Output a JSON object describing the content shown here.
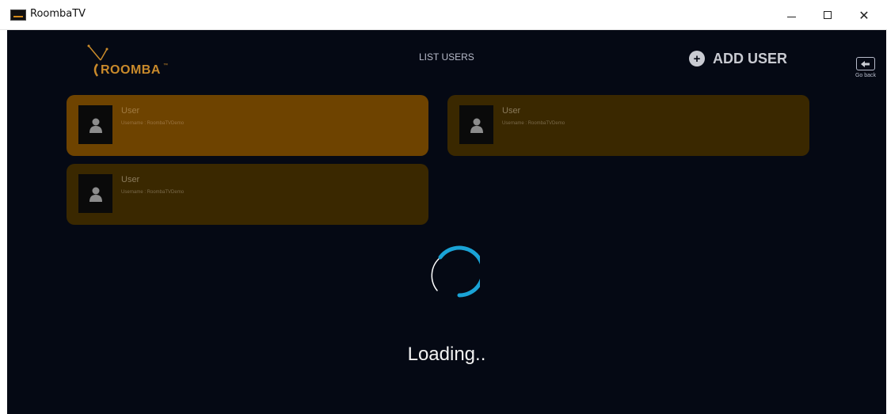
{
  "window": {
    "title": "RoombaTV",
    "minimize_glyph": "",
    "maximize_glyph": "",
    "close_glyph": "✕"
  },
  "header": {
    "logo_text": "ROOMBA",
    "logo_tm": "™",
    "title": "LIST USERS",
    "add_user_label": "ADD USER",
    "add_user_icon": "+",
    "go_back_label": "Go back"
  },
  "users": [
    {
      "name": "User",
      "username": "Username : RoombaTVDemo",
      "selected": true
    },
    {
      "name": "User",
      "username": "Username : RoombaTVDemo",
      "selected": false
    },
    {
      "name": "User",
      "username": "Username : RoombaTVDemo",
      "selected": false
    }
  ],
  "loading": {
    "text": "Loading.."
  },
  "colors": {
    "background": "#050914",
    "card_selected": "#6e4300",
    "card": "#3a2800",
    "spinner": "#1aa3d6",
    "accent": "#c98a2b"
  }
}
